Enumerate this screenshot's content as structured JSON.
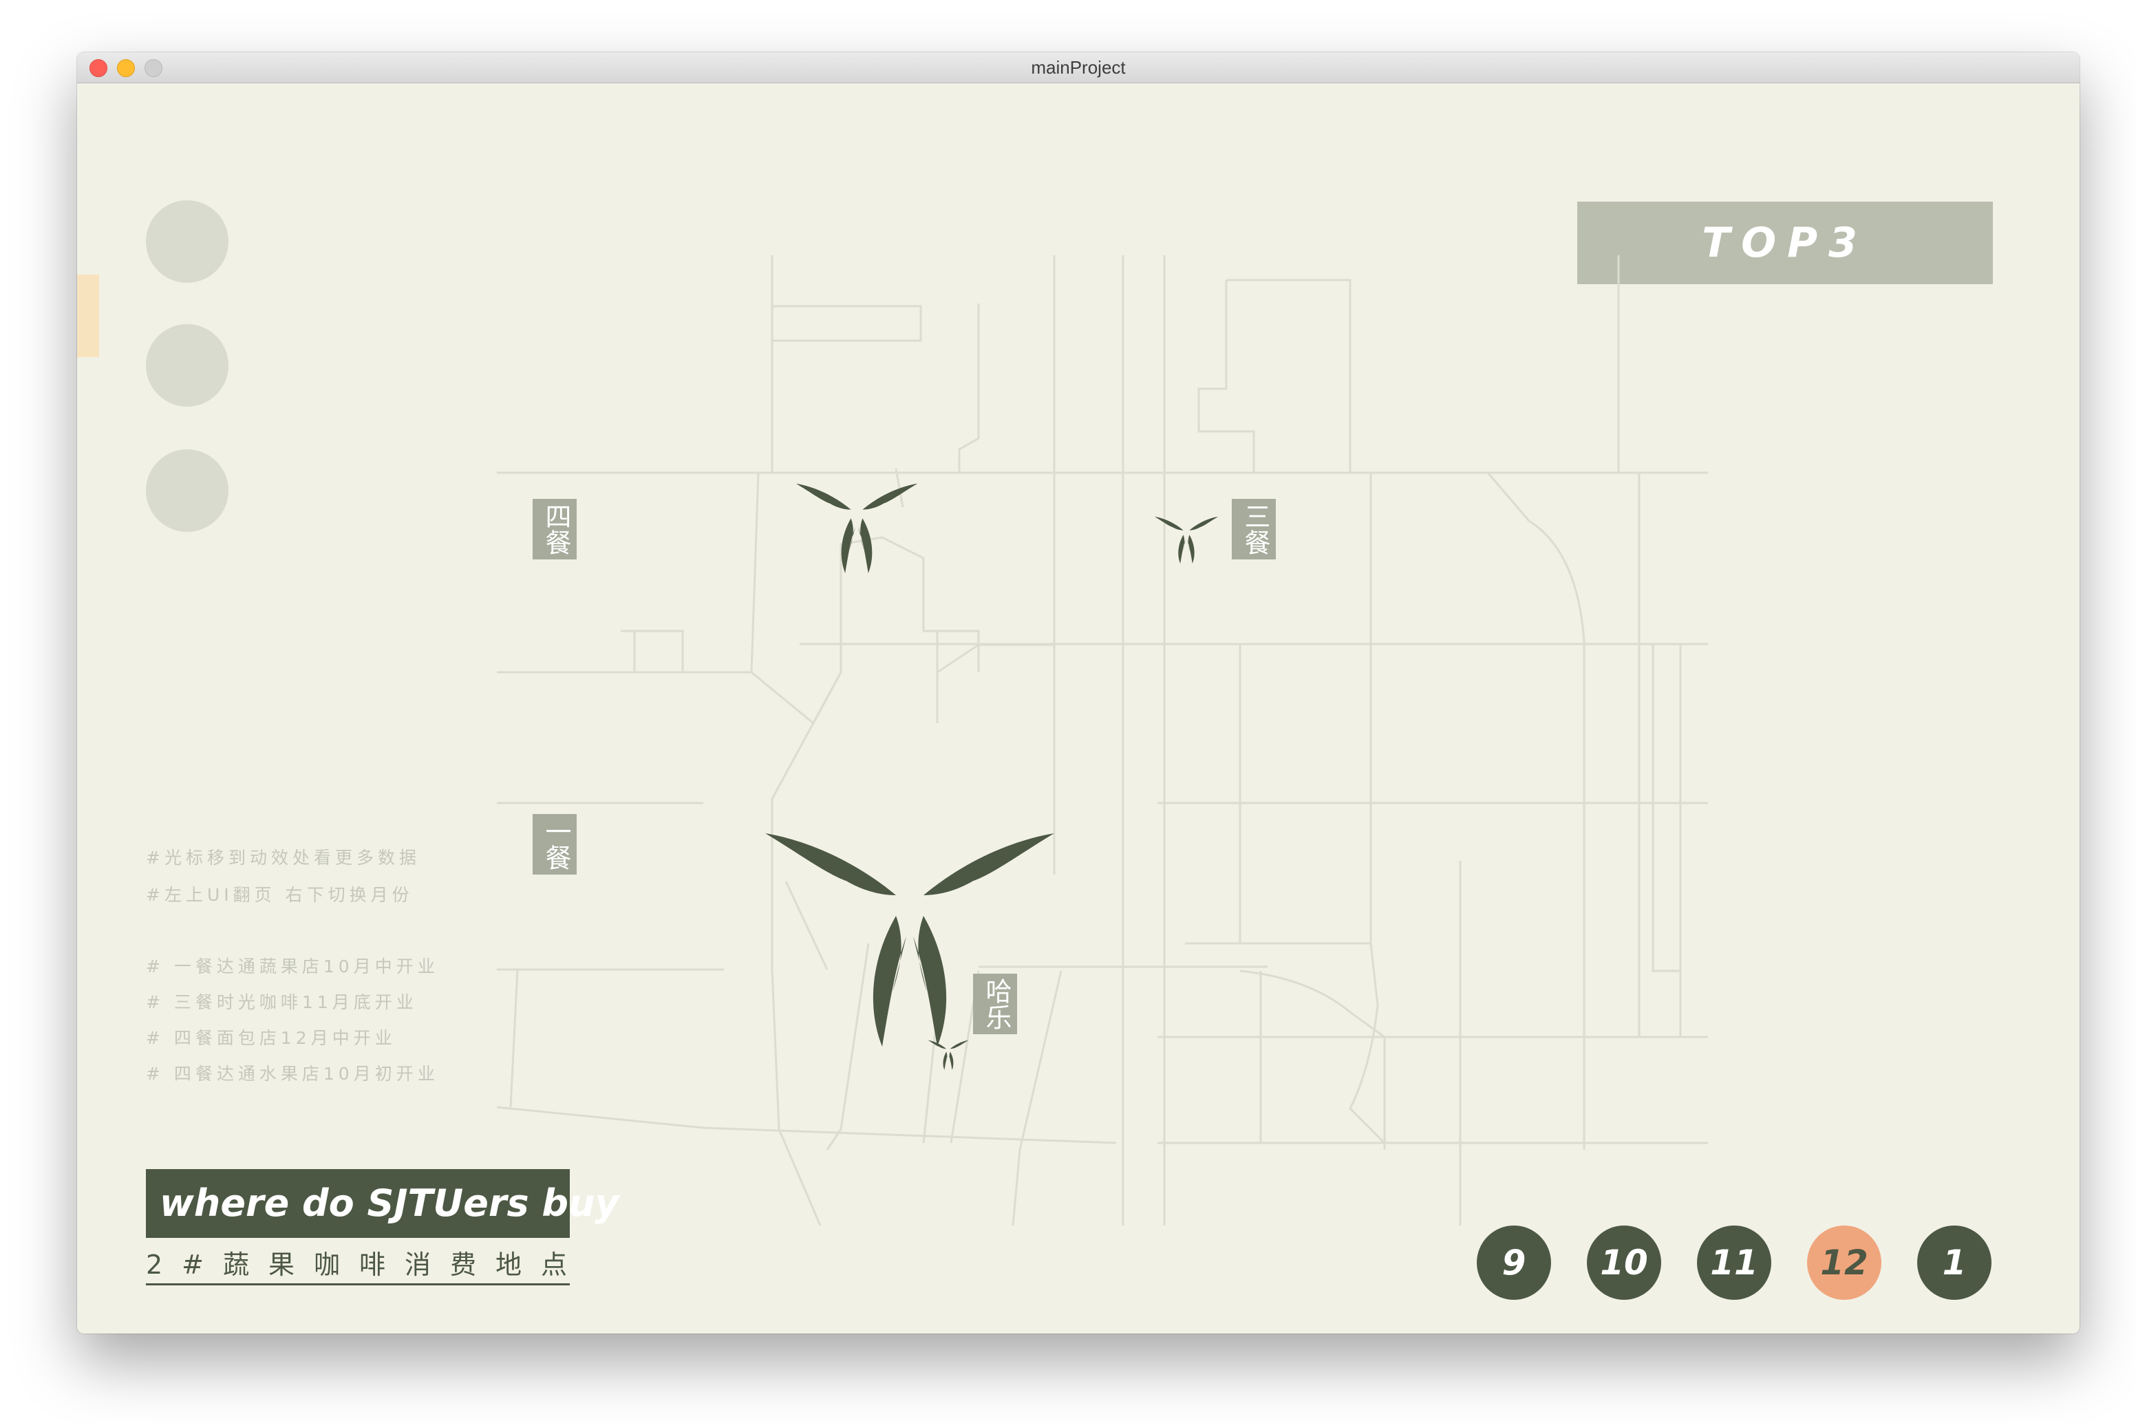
{
  "window": {
    "title": "mainProject"
  },
  "header": {
    "top_label": "TOP3"
  },
  "venues": [
    {
      "name": "四餐"
    },
    {
      "name": "三餐"
    },
    {
      "name": "一餐"
    },
    {
      "name": "哈乐"
    }
  ],
  "hints": [
    "#光标移到动效处看更多数据",
    "#左上UI翻页 右下切换月份"
  ],
  "notes": [
    "# 一餐达通蔬果店10月中开业",
    "# 三餐时光咖啡11月底开业",
    "# 四餐面包店12月中开业",
    "# 四餐达通水果店10月初开业"
  ],
  "brand": {
    "title": "where do SJTUers buy",
    "subtitle": "2#蔬果咖啡消费地点"
  },
  "months": [
    {
      "label": "9",
      "active": false
    },
    {
      "label": "10",
      "active": false
    },
    {
      "label": "11",
      "active": false
    },
    {
      "label": "12",
      "active": true
    },
    {
      "label": "1",
      "active": false
    }
  ],
  "colors": {
    "background": "#f2f1e6",
    "dark_green": "#4c5844",
    "label_gray": "#a6ab9b",
    "accent_orange": "#f0a67d",
    "map_line": "#dcdcd0"
  }
}
